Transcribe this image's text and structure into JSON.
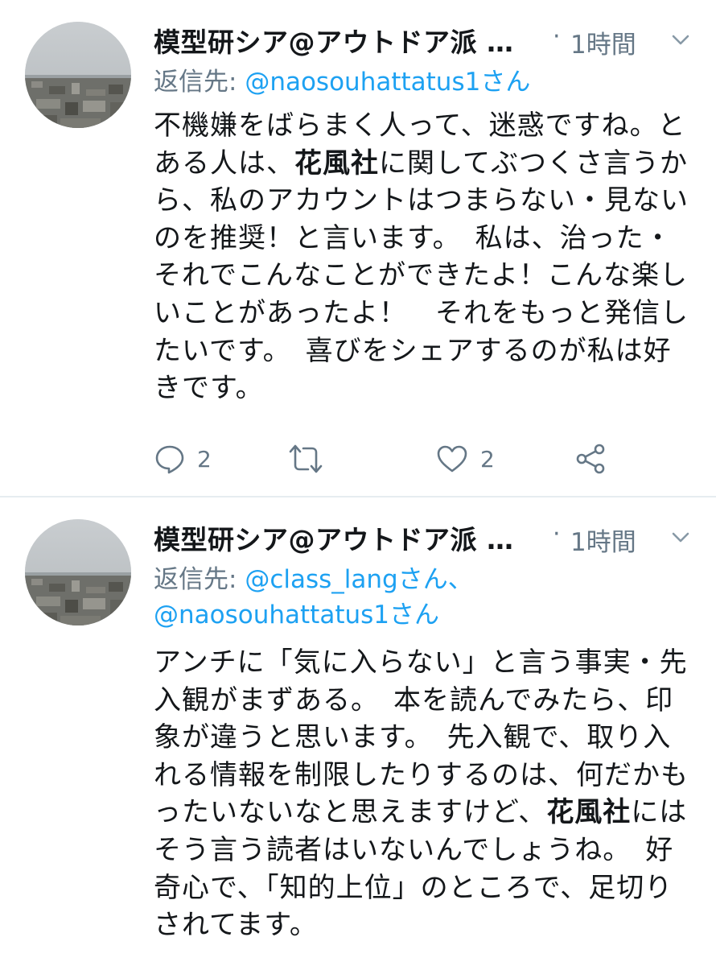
{
  "tweets": [
    {
      "author_name": "模型研シア@アウトドア派 …",
      "separator": "·",
      "time": "1時間",
      "reply_prefix": "返信先: ",
      "reply_handles": "@naosouhattatus1さん",
      "body_parts": [
        {
          "text": "不機嫌をばらまく人って、迷惑ですね。とある人は、",
          "bold": false
        },
        {
          "text": "花風社",
          "bold": true
        },
        {
          "text": "に関してぶつくさ言うから、私のアカウントはつまらない・見ないのを推奨！と言います。　私は、治った・それでこんなことができたよ！こんな楽しいことがあったよ！　それをもっと発信したいです。　喜びをシェアするのが私は好きです。",
          "bold": false
        }
      ],
      "reply_count": "2",
      "retweet_count": "",
      "like_count": "2",
      "icons": [
        "chat-bubble-icon",
        "retweet-icon",
        "heart-icon",
        "share-icon",
        "chevron-down-icon"
      ]
    },
    {
      "author_name": "模型研シア@アウトドア派 …",
      "separator": "·",
      "time": "1時間",
      "reply_prefix": "返信先: ",
      "reply_handles": "@class_langさん、@naosouhattatus1さん",
      "body_parts": [
        {
          "text": "アンチに「気に入らない」と言う事実・先入観がまずある。　本を読んでみたら、印象が違うと思います。　先入観で、取り入れる情報を制限したりするのは、何だかもったいないなと思えますけど、",
          "bold": false
        },
        {
          "text": "花風社",
          "bold": true
        },
        {
          "text": "にはそう言う読者はいないんでしょうね。　好奇心で、「知的上位」のところで、足切りされてます。",
          "bold": false
        }
      ]
    }
  ],
  "colors": {
    "text": "#14171a",
    "secondary": "#657786",
    "link": "#1da1f2",
    "divider": "#e6ecf0"
  }
}
